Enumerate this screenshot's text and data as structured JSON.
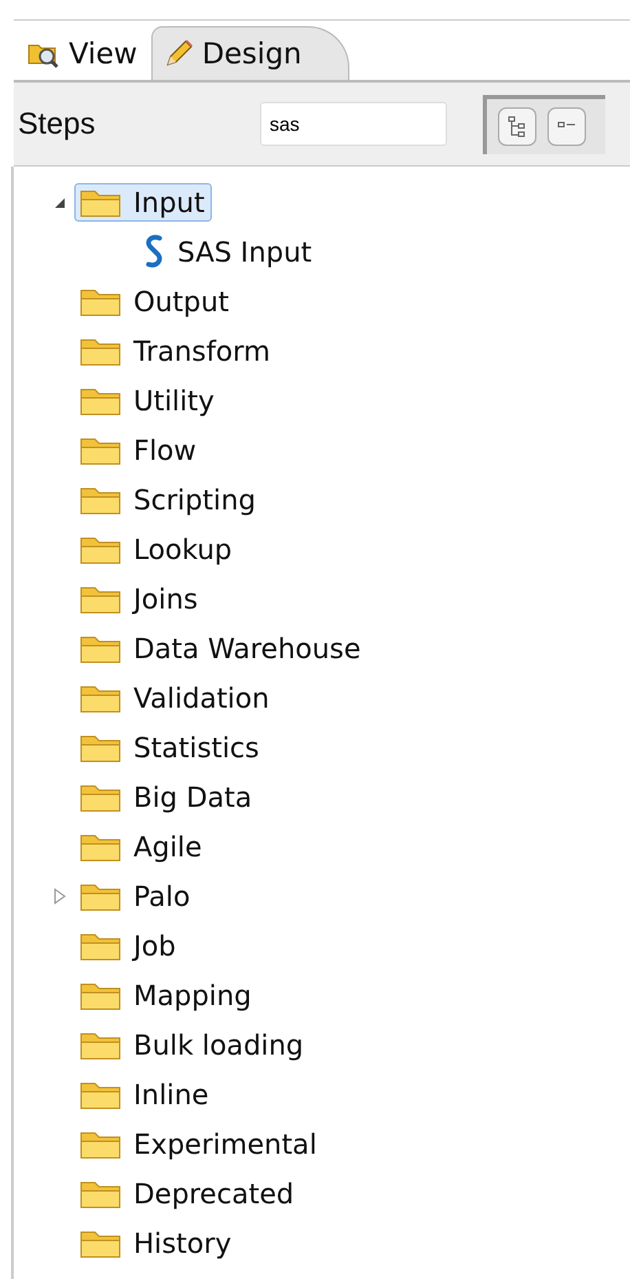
{
  "tabs": [
    {
      "label": "View",
      "kind": "view",
      "selected": false
    },
    {
      "label": "Design",
      "kind": "design",
      "selected": true
    }
  ],
  "steps": {
    "label": "Steps",
    "search": {
      "value": "sas"
    }
  },
  "tree": [
    {
      "label": "Input",
      "selected": true,
      "expanded": true,
      "children": [
        {
          "label": "SAS Input",
          "kind": "step",
          "selected": false
        }
      ]
    },
    {
      "label": "Output",
      "selected": false
    },
    {
      "label": "Transform",
      "selected": false
    },
    {
      "label": "Utility",
      "selected": false
    },
    {
      "label": "Flow",
      "selected": false
    },
    {
      "label": "Scripting",
      "selected": false
    },
    {
      "label": "Lookup",
      "selected": false
    },
    {
      "label": "Joins",
      "selected": false
    },
    {
      "label": "Data Warehouse",
      "selected": false
    },
    {
      "label": "Validation",
      "selected": false
    },
    {
      "label": "Statistics",
      "selected": false
    },
    {
      "label": "Big Data",
      "selected": false
    },
    {
      "label": "Agile",
      "selected": false
    },
    {
      "label": "Palo",
      "selected": false,
      "expanded": false
    },
    {
      "label": "Job",
      "selected": false
    },
    {
      "label": "Mapping",
      "selected": false
    },
    {
      "label": "Bulk loading",
      "selected": false
    },
    {
      "label": "Inline",
      "selected": false
    },
    {
      "label": "Experimental",
      "selected": false
    },
    {
      "label": "Deprecated",
      "selected": false
    },
    {
      "label": "History",
      "selected": false
    }
  ]
}
